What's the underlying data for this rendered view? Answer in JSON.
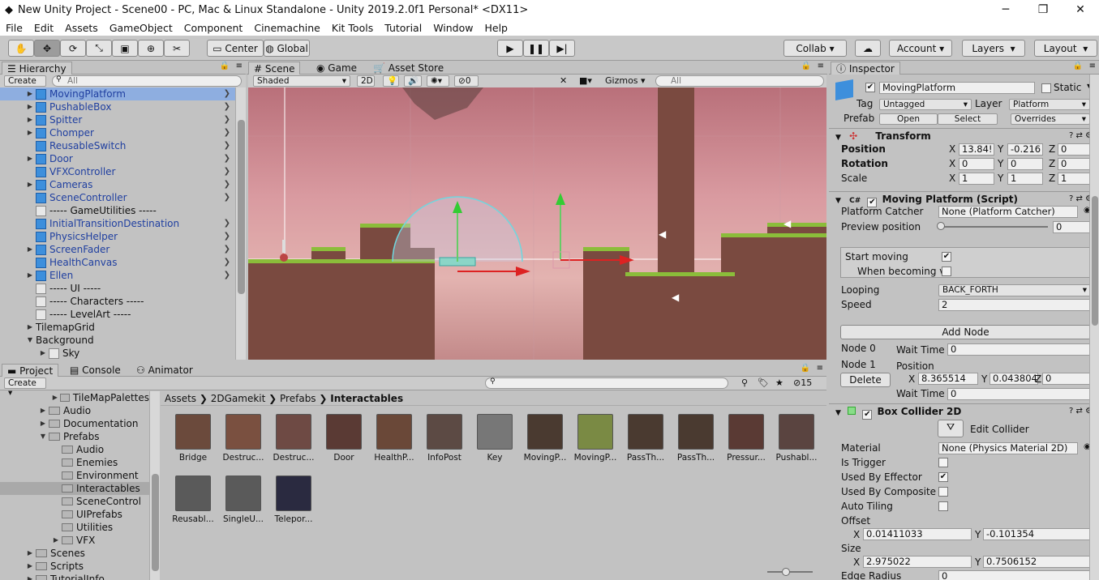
{
  "title": "New Unity Project - Scene00 - PC, Mac & Linux Standalone - Unity 2019.2.0f1 Personal* <DX11>",
  "menu": [
    "File",
    "Edit",
    "Assets",
    "GameObject",
    "Component",
    "Cinemachine",
    "Kit Tools",
    "Tutorial",
    "Window",
    "Help"
  ],
  "toolbar": {
    "center": "Center",
    "global": "Global",
    "collab": "Collab",
    "account": "Account",
    "layers": "Layers",
    "layout": "Layout"
  },
  "hierarchy": {
    "tab": "Hierarchy",
    "create": "Create",
    "search": "All",
    "items": [
      {
        "label": "MovingPlatform",
        "blue": true,
        "arrow": "▶",
        "sel": true
      },
      {
        "label": "PushableBox",
        "blue": true,
        "arrow": "▶"
      },
      {
        "label": "Spitter",
        "blue": true,
        "arrow": "▶"
      },
      {
        "label": "Chomper",
        "blue": true,
        "arrow": "▶"
      },
      {
        "label": "ReusableSwitch",
        "blue": true,
        "arrow": ""
      },
      {
        "label": "Door",
        "blue": true,
        "arrow": "▶"
      },
      {
        "label": "VFXController",
        "blue": true,
        "arrow": ""
      },
      {
        "label": "Cameras",
        "blue": true,
        "arrow": "▶"
      },
      {
        "label": "SceneController",
        "blue": true,
        "arrow": ""
      },
      {
        "label": "----- GameUtilities -----",
        "blue": false,
        "arrow": ""
      },
      {
        "label": "InitialTransitionDestination",
        "blue": true,
        "arrow": ""
      },
      {
        "label": "PhysicsHelper",
        "blue": true,
        "arrow": ""
      },
      {
        "label": "ScreenFader",
        "blue": true,
        "arrow": "▶"
      },
      {
        "label": "HealthCanvas",
        "blue": true,
        "arrow": ""
      },
      {
        "label": "Ellen",
        "blue": true,
        "arrow": "▶"
      },
      {
        "label": "----- UI -----",
        "blue": false,
        "arrow": ""
      },
      {
        "label": "----- Characters -----",
        "blue": false,
        "arrow": ""
      },
      {
        "label": "----- LevelArt -----",
        "blue": false,
        "arrow": ""
      },
      {
        "label": "TilemapGrid",
        "blue": false,
        "arrow": "▶",
        "nocube": true
      },
      {
        "label": "Background",
        "blue": false,
        "arrow": "▼",
        "nocube": true
      },
      {
        "label": "Sky",
        "blue": false,
        "arrow": "▶",
        "indent": true
      }
    ]
  },
  "scene": {
    "tabs": [
      "Scene",
      "Game",
      "Asset Store"
    ],
    "shaded": "Shaded",
    "mode2d": "2D",
    "fxcount": "0",
    "gizmos": "Gizmos",
    "search": "All"
  },
  "inspector": {
    "tab": "Inspector",
    "name": "MovingPlatform",
    "static": "Static",
    "tag_label": "Tag",
    "tag": "Untagged",
    "layer_label": "Layer",
    "layer": "Platform",
    "prefab_label": "Prefab",
    "open": "Open",
    "select": "Select",
    "overrides": "Overrides",
    "transform": {
      "title": "Transform",
      "position": "Position",
      "rotation": "Rotation",
      "scale": "Scale",
      "px": "13.84!",
      "py": "-0.216",
      "pz": "0",
      "rx": "0",
      "ry": "0",
      "rz": "0",
      "sx": "1",
      "sy": "1",
      "sz": "1"
    },
    "mp": {
      "title": "Moving Platform (Script)",
      "catcher_label": "Platform Catcher",
      "catcher": "None (Platform Catcher)",
      "preview_label": "Preview position",
      "preview": "0",
      "start_label": "Start moving",
      "becoming_label": "When becoming vi",
      "looping_label": "Looping",
      "looping": "BACK_FORTH",
      "speed_label": "Speed",
      "speed": "2",
      "add_node": "Add Node",
      "node0": "Node 0",
      "node1": "Node 1",
      "wait_label": "Wait Time",
      "wait0": "0",
      "position_label": "Position",
      "delete": "Delete",
      "n1x": "8.365514",
      "n1y": "0.0438044",
      "n1z": "0",
      "wait1": "0"
    },
    "bc": {
      "title": "Box Collider 2D",
      "edit": "Edit Collider",
      "material_label": "Material",
      "material": "None (Physics Material 2D)",
      "trigger": "Is Trigger",
      "effector": "Used By Effector",
      "composite": "Used By Composite",
      "tiling": "Auto Tiling",
      "offset": "Offset",
      "ox": "0.01411033",
      "oy": "-0.101354",
      "size": "Size",
      "sx": "2.975022",
      "sy": "0.7506152",
      "edge": "Edge Radius",
      "edgev": "0"
    }
  },
  "bottom": {
    "tabs": [
      "Project",
      "Console",
      "Animator"
    ],
    "create": "Create",
    "count": "15",
    "tree": [
      {
        "label": "TileMapPalettes",
        "lvl": 3,
        "arrow": "▶"
      },
      {
        "label": "Audio",
        "lvl": 2,
        "arrow": "▶"
      },
      {
        "label": "Documentation",
        "lvl": 2,
        "arrow": "▶"
      },
      {
        "label": "Prefabs",
        "lvl": 2,
        "arrow": "▼"
      },
      {
        "label": "Audio",
        "lvl": 3,
        "arrow": ""
      },
      {
        "label": "Enemies",
        "lvl": 3,
        "arrow": ""
      },
      {
        "label": "Environment",
        "lvl": 3,
        "arrow": ""
      },
      {
        "label": "Interactables",
        "lvl": 3,
        "arrow": "",
        "sel": true
      },
      {
        "label": "SceneControl",
        "lvl": 3,
        "arrow": ""
      },
      {
        "label": "UIPrefabs",
        "lvl": 3,
        "arrow": ""
      },
      {
        "label": "Utilities",
        "lvl": 3,
        "arrow": ""
      },
      {
        "label": "VFX",
        "lvl": 3,
        "arrow": "▶"
      },
      {
        "label": "Scenes",
        "lvl": 1,
        "arrow": "▶"
      },
      {
        "label": "Scripts",
        "lvl": 1,
        "arrow": "▶"
      },
      {
        "label": "TutorialInfo",
        "lvl": 1,
        "arrow": "▶"
      }
    ],
    "breadcrumb": [
      "Assets",
      "2DGamekit",
      "Prefabs",
      "Interactables"
    ],
    "assets": [
      "Bridge",
      "Destruc...",
      "Destruc...",
      "Door",
      "HealthP...",
      "InfoPost",
      "Key",
      "MovingP...",
      "MovingP...",
      "PassTh...",
      "PassTh...",
      "Pressur...",
      "Pushabl...",
      "Reusabl...",
      "SingleU...",
      "Telepor..."
    ]
  }
}
